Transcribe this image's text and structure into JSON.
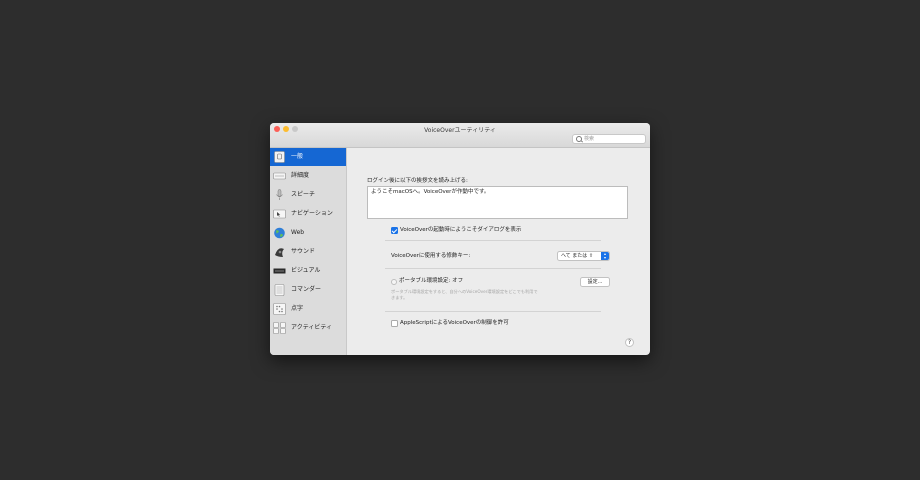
{
  "window": {
    "title": "VoiceOverユーティリティ"
  },
  "search": {
    "placeholder": "検索"
  },
  "sidebar": {
    "items": [
      {
        "label": "一般",
        "icon": "general-icon",
        "selected": true
      },
      {
        "label": "詳細度",
        "icon": "verbosity-icon"
      },
      {
        "label": "スピーチ",
        "icon": "speech-icon"
      },
      {
        "label": "ナビゲーション",
        "icon": "navigation-icon"
      },
      {
        "label": "Web",
        "icon": "web-globe-icon"
      },
      {
        "label": "サウンド",
        "icon": "sound-icon"
      },
      {
        "label": "ビジュアル",
        "icon": "visuals-icon"
      },
      {
        "label": "コマンダー",
        "icon": "commanders-icon"
      },
      {
        "label": "点字",
        "icon": "braille-icon"
      },
      {
        "label": "アクティビティ",
        "icon": "activities-icon"
      }
    ]
  },
  "general": {
    "greeting_label": "ログイン後に以下の挨拶文を読み上げる:",
    "greeting_text": "ようこそmacOSへ。VoiceOverが作動中です。",
    "welcome_dialog_label": "VoiceOverの起動時にようこそダイアログを表示",
    "welcome_dialog_checked": true,
    "modifier_label": "VoiceOverに使用する修飾キー:",
    "modifier_value": "へて または ⇪",
    "portable_label": "ポータブル環境設定: オフ",
    "portable_desc": "ポータブル環境設定をすると、自分へのVoiceOver環境設定をどこでも利用できます。",
    "settings_button": "設定...",
    "applescript_label": "AppleScriptによるVoiceOverの制御を許可",
    "applescript_checked": false,
    "help_label": "?"
  },
  "colors": {
    "accent": "#1a73e8",
    "selected": "#1567d3",
    "desktop": "#2d2d2d"
  }
}
